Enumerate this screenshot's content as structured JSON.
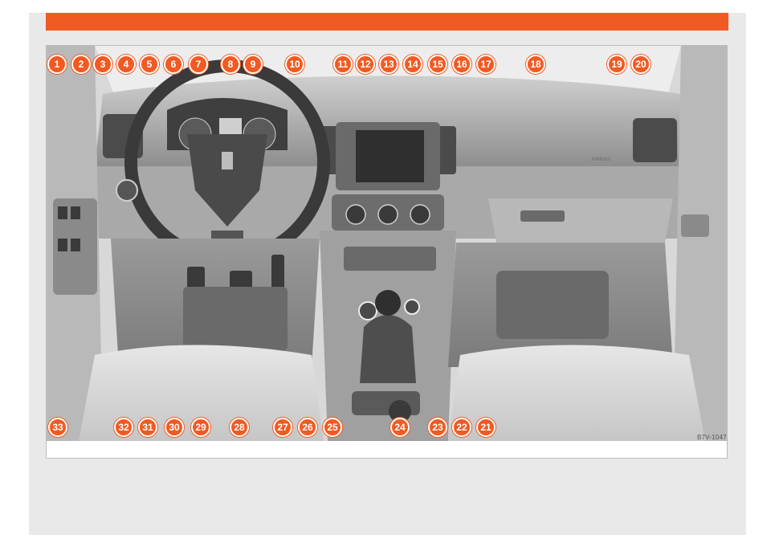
{
  "colors": {
    "accent": "#f15a22",
    "page_background": "#e9e9e9",
    "figure_border": "#bdbdbd"
  },
  "figure": {
    "code": "B7V-1047",
    "airbag_label": "AIRBAG",
    "callouts": [
      "1",
      "2",
      "3",
      "4",
      "5",
      "6",
      "7",
      "8",
      "9",
      "10",
      "11",
      "12",
      "13",
      "14",
      "15",
      "16",
      "17",
      "18",
      "19",
      "20",
      "21",
      "22",
      "23",
      "24",
      "25",
      "26",
      "27",
      "28",
      "29",
      "30",
      "31",
      "32",
      "33"
    ]
  }
}
